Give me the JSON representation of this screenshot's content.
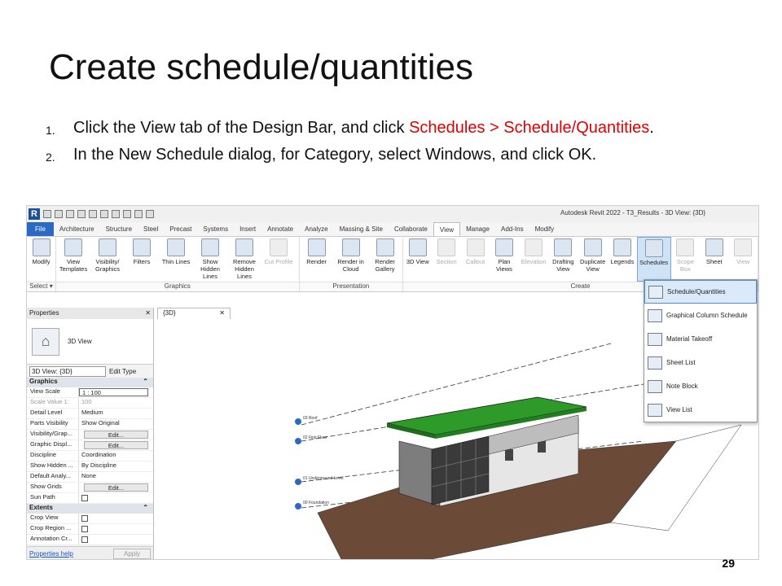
{
  "slide": {
    "title": "Create schedule/quantities",
    "steps": [
      {
        "num": "1.",
        "pre": "Click the View tab of the Design Bar, and click ",
        "highlight": "Schedules > Schedule/Quantities",
        "post": "."
      },
      {
        "num": "2.",
        "pre": "In the New Schedule dialog, for Category, select Windows, and click OK.",
        "highlight": "",
        "post": ""
      }
    ],
    "page_number": "29",
    "highlight_color": "#e00000"
  },
  "app": {
    "logo": "R",
    "title": "Autodesk Revit 2022 - T3_Results - 3D View: {3D}",
    "tabs": [
      "File",
      "Architecture",
      "Structure",
      "Steel",
      "Precast",
      "Systems",
      "Insert",
      "Annotate",
      "Analyze",
      "Massing & Site",
      "Collaborate",
      "View",
      "Manage",
      "Add-Ins",
      "Modify"
    ],
    "active_tab": "View"
  },
  "ribbon": {
    "select_panel": {
      "tools": [
        "Modify"
      ],
      "label": "Select ▾"
    },
    "graphics_panel": {
      "tools": [
        "View Templates",
        "Visibility/ Graphics",
        "Filters",
        "Thin Lines",
        "Show Hidden Lines",
        "Remove Hidden Lines",
        "Cut Profile"
      ],
      "label": "Graphics"
    },
    "presentation_panel": {
      "tools": [
        "Render",
        "Render in Cloud",
        "Render Gallery"
      ],
      "label": "Presentation"
    },
    "create_panel": {
      "tools": [
        "3D View",
        "Section",
        "Callout",
        "Plan Views",
        "Elevation",
        "Drafting View",
        "Duplicate View",
        "Legends",
        "Schedules",
        "Scope Box",
        "Sheet",
        "View"
      ],
      "label": "Create"
    }
  },
  "schedules_menu": {
    "items": [
      "Schedule/Quantities",
      "Graphical Column Schedule",
      "Material Takeoff",
      "Sheet List",
      "Note Block",
      "View List"
    ],
    "selected": "Schedule/Quantities"
  },
  "properties": {
    "header": "Properties",
    "type_name": "3D View",
    "instance": "3D View: {3D}",
    "edit_type": "Edit Type",
    "groups": [
      {
        "name": "Graphics",
        "rows": [
          {
            "k": "View Scale",
            "v": "1 : 100",
            "kind": "input"
          },
          {
            "k": "Scale Value   1:",
            "v": "100",
            "kind": "grey"
          },
          {
            "k": "Detail Level",
            "v": "Medium",
            "kind": "text"
          },
          {
            "k": "Parts Visibility",
            "v": "Show Original",
            "kind": "text"
          },
          {
            "k": "Visibility/Grap...",
            "v": "Edit...",
            "kind": "btn"
          },
          {
            "k": "Graphic Displ...",
            "v": "Edit...",
            "kind": "btn"
          },
          {
            "k": "Discipline",
            "v": "Coordination",
            "kind": "text"
          },
          {
            "k": "Show Hidden ...",
            "v": "By Discipline",
            "kind": "text"
          },
          {
            "k": "Default Analy...",
            "v": "None",
            "kind": "text"
          },
          {
            "k": "Show Grids",
            "v": "Edit...",
            "kind": "btn"
          },
          {
            "k": "Sun Path",
            "v": "",
            "kind": "check"
          }
        ]
      },
      {
        "name": "Extents",
        "rows": [
          {
            "k": "Crop View",
            "v": "",
            "kind": "check"
          },
          {
            "k": "Crop Region ...",
            "v": "",
            "kind": "check"
          },
          {
            "k": "Annotation Cr...",
            "v": "",
            "kind": "check"
          }
        ]
      }
    ],
    "help_link": "Properties help",
    "apply": "Apply"
  },
  "view_tab": {
    "label": "{3D}"
  },
  "levels": [
    "03 Roof",
    "02 First Floor",
    "01 Underground Level",
    "00 Foundation"
  ],
  "colors": {
    "roof": "#2e9a2a",
    "ground": "#6b4a38",
    "accent": "#2a6ac4"
  }
}
